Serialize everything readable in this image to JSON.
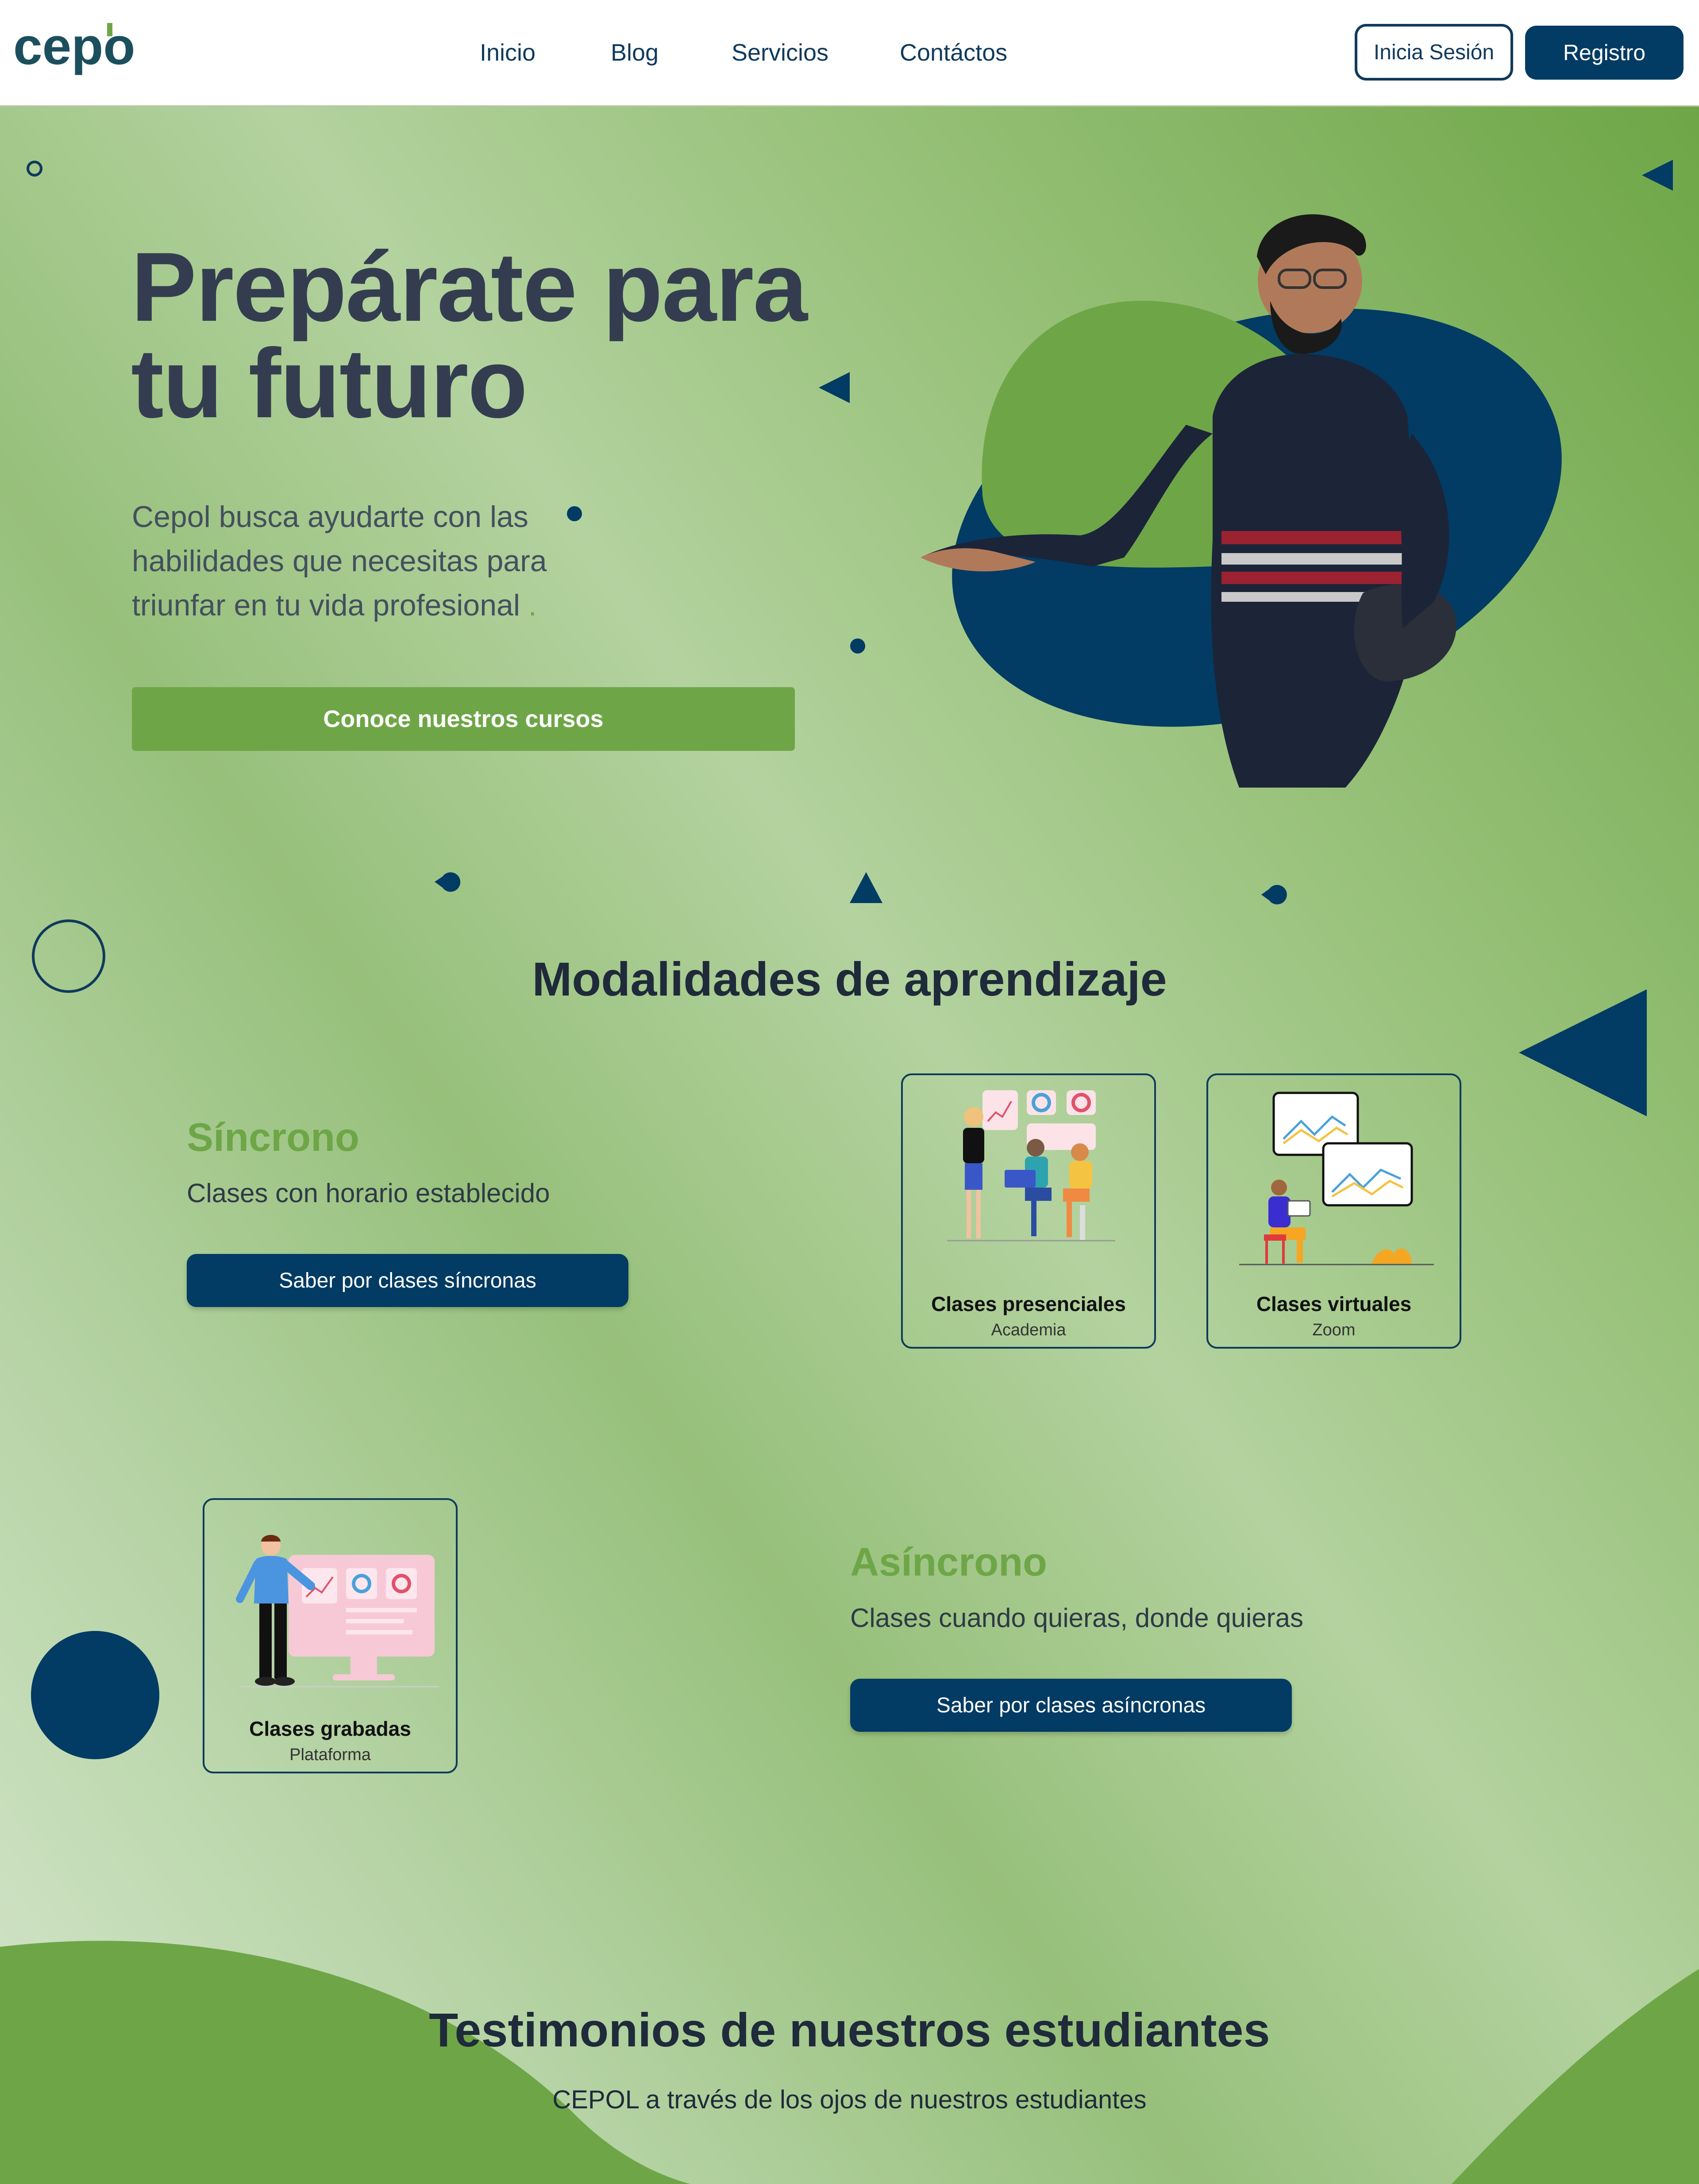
{
  "brand": {
    "logo_text": "cepol"
  },
  "nav": {
    "links": [
      "Inicio",
      "Blog",
      "Servicios",
      "Contáctos"
    ],
    "login_label": "Inicia Sesión",
    "register_label": "Registro"
  },
  "hero": {
    "title_line1": "Prepárate para",
    "title_line2": "tu futuro",
    "subtitle_line1": "Cepol busca ayudarte con las",
    "subtitle_line2": "habilidades que necesitas para",
    "subtitle_line3": "triunfar en tu vida profesional",
    "subtitle_dot": ".",
    "cta_label": "Conoce nuestros cursos"
  },
  "modalidades": {
    "title": "Modalidades de aprendizaje",
    "sincrono": {
      "heading": "Síncrono",
      "description": "Clases con horario establecido",
      "button_label": "Saber por clases síncronas",
      "cards": [
        {
          "title": "Clases presenciales",
          "subtitle": "Academia"
        },
        {
          "title": "Clases virtuales",
          "subtitle": "Zoom"
        }
      ]
    },
    "asincrono": {
      "heading": "Asíncrono",
      "description": "Clases cuando quieras, donde quieras",
      "button_label": "Saber por clases asíncronas",
      "cards": [
        {
          "title": "Clases grabadas",
          "subtitle": "Plataforma"
        }
      ]
    }
  },
  "testimonios": {
    "title": "Testimonios de nuestros estudiantes",
    "subtitle": "CEPOL a través de los ojos de nuestros estudiantes"
  },
  "colors": {
    "primary_navy": "#023b63",
    "accent_green": "#6ea647",
    "heading_dark": "#343d50"
  }
}
